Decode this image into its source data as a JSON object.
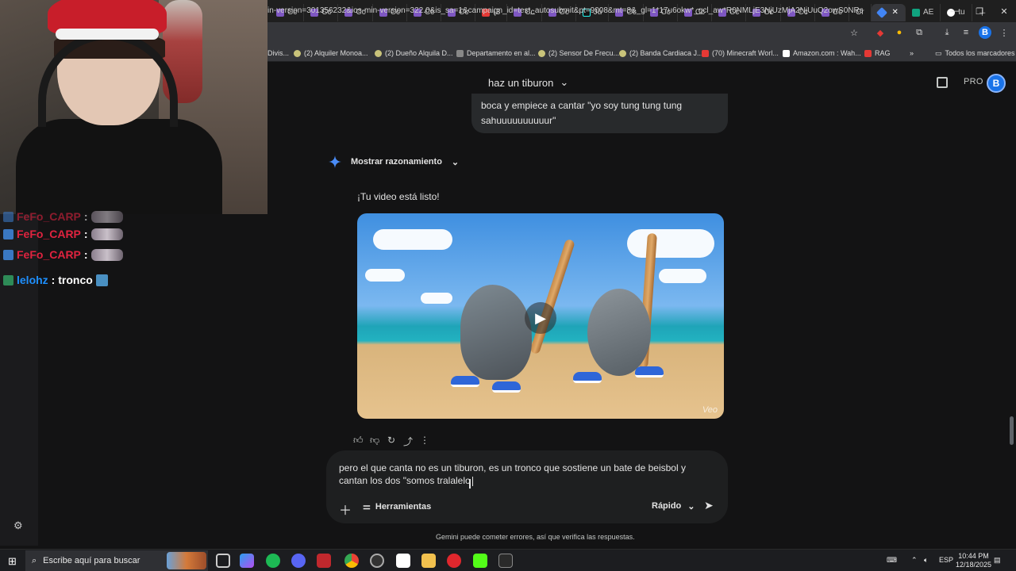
{
  "browser": {
    "tabs": [
      "Cc",
      "Cc",
      "Cc",
      "Cc",
      "Cc",
      "Cc",
      "(3",
      "Cc",
      "Cc",
      "Jú",
      "Cc",
      "Cc",
      "Cc",
      "Cc",
      "Cc",
      "Cc",
      "Cc",
      "Cr",
      "",
      "AE",
      "tu"
    ],
    "url": "in-version=301356232&ios-min-version=322.0&is_sa=1&campaign_id=test_autosubmit&pt=9008&mt=8&_gl=1*17u6okw*_gcl_aw*R0NMLjE3NjUzMjA2NjUuQ2owS0NRaUFy...",
    "bookmarks": [
      "Divis...",
      "(2) Alquiler Monoa...",
      "(2) Dueño Alquila D...",
      "Departamento en al...",
      "(2) Sensor De Frecu...",
      "(2) Banda Cardiaca J...",
      "(70) Minecraft Worl...",
      "Amazon.com : Wah...",
      "RAG"
    ],
    "all_bookmarks": "Todos los marcadores",
    "avatar_letter": "B"
  },
  "chat": {
    "messages": [
      {
        "user": "FeFo_CARP",
        "text": ":",
        "color": "#e0233f"
      },
      {
        "user": "FeFo_CARP",
        "text": ":",
        "color": "#e0233f"
      },
      {
        "user": "FeFo_CARP",
        "text": ":",
        "color": "#e0233f"
      },
      {
        "user": "lelohz",
        "text": ": tronco",
        "color": "#1e90ff"
      }
    ]
  },
  "gemini": {
    "conversation_title": "haz un tiburon",
    "pro_label": "PRO",
    "avatar_letter": "B",
    "user_message": "boca y empiece a cantar \"yo soy tung tung tung sahuuuuuuuuuur\"",
    "reasoning_label": "Mostrar razonamiento",
    "response_text": "¡Tu video está listo!",
    "video_watermark": "Veo",
    "composer_text": "pero el que canta no es un tiburon, es un tronco que sostiene un bate de beisbol y cantan los dos \"somos tralalelo",
    "tools_label": "Herramientas",
    "mode_label": "Rápido",
    "disclaimer": "Gemini puede cometer errores, así que verifica las respuestas."
  },
  "taskbar": {
    "search_placeholder": "Escribe aquí para buscar",
    "language": "ESP",
    "time": "10:44 PM",
    "date": "12/18/2025"
  },
  "colors": {
    "accent_blue": "#1a73e8",
    "background": "#131314",
    "bubble": "#282a2c"
  }
}
